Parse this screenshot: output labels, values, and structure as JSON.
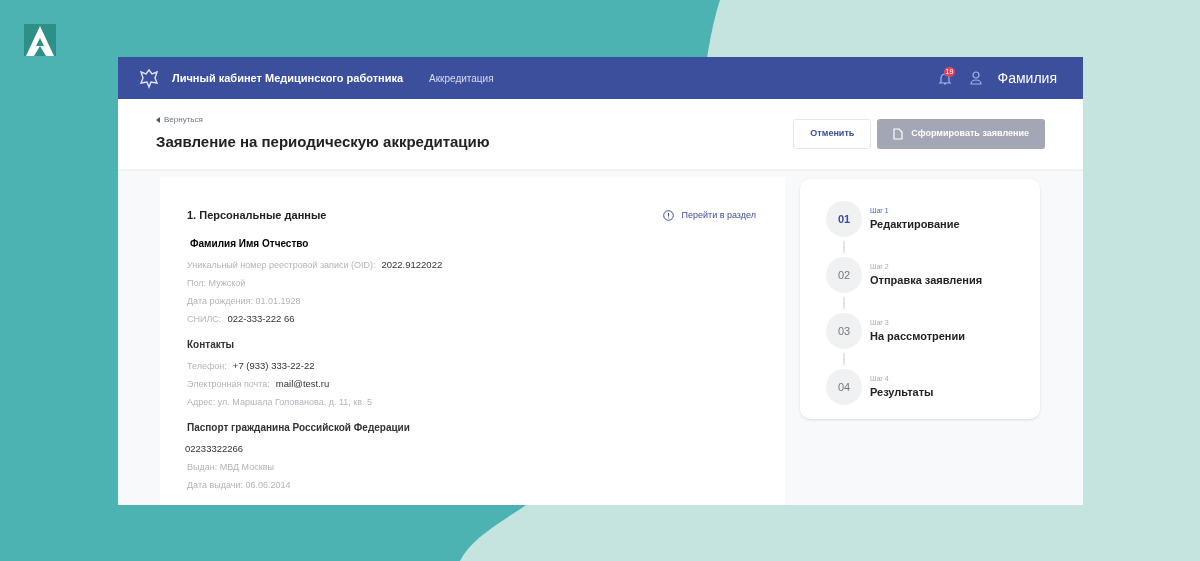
{
  "header": {
    "title": "Личный кабинет Медицинского работника",
    "nav_link": "Аккредитация",
    "notifications": "19",
    "user_name": "Фамилия"
  },
  "page": {
    "back_link": "Вернуться",
    "title": "Заявление на периодическую аккредитацию"
  },
  "buttons": [
    {
      "label": "Отменить",
      "disabled": false
    },
    {
      "label": "Сформировать заявление",
      "disabled": true
    }
  ],
  "section": {
    "title": "1. Персональные данные",
    "link": "Перейти в раздел",
    "groups": [
      {
        "heading": "Фамилия Имя Отчество",
        "kind": "name",
        "rows": [
          {
            "label": "Уникальный номер реестровой записи (OID):",
            "value": "2022.9122022"
          },
          {
            "label": "Пол: Мужской"
          },
          {
            "label": "Дата рождения: 01.01.1928"
          },
          {
            "label": "СНИЛС:",
            "value": "022-333-222 66"
          }
        ]
      },
      {
        "heading": "Контакты",
        "kind": "section",
        "rows": [
          {
            "label": "Телефон:",
            "value": "+7 (933) 333-22-22"
          },
          {
            "label": "Электронная почта:",
            "value": "mail@test.ru"
          },
          {
            "label": "Адрес: ул. Маршала Голованова, д. 11, кв. 5"
          }
        ]
      },
      {
        "heading": "Паспорт гражданина Российской Федерации",
        "kind": "section",
        "rows": [
          {
            "value": "02233322266"
          },
          {
            "label": "Выдан: МВД Москвы"
          },
          {
            "label": "Дата выдачи: 06.06.2014"
          }
        ]
      }
    ]
  },
  "steps": [
    {
      "number": "01",
      "step": "Шаг 1",
      "title": "Редактирование",
      "selected": true
    },
    {
      "number": "02",
      "step": "Шаг 2",
      "title": "Отправка заявления",
      "selected": false
    },
    {
      "number": "03",
      "step": "Шаг 3",
      "title": "На рассмотрении",
      "selected": false
    },
    {
      "number": "04",
      "step": "Шаг 4",
      "title": "Результаты",
      "selected": false
    }
  ]
}
